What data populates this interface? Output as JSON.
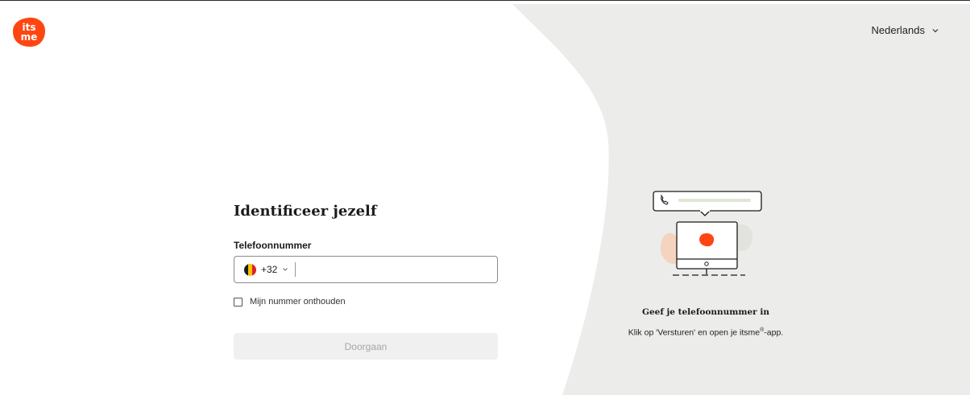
{
  "brand": {
    "logo_line1": "its",
    "logo_line2": "me",
    "accent": "#ff4612",
    "panel_bg": "#ececea"
  },
  "header": {
    "language": "Nederlands",
    "language_icon": "chevron-down-icon"
  },
  "form": {
    "title": "Identificeer jezelf",
    "phone_label": "Telefoonnummer",
    "country_code": "+32",
    "country_flag": "belgium-flag-icon",
    "phone_value": "",
    "remember_label": "Mijn nummer onthouden",
    "remember_checked": false,
    "continue_label": "Doorgaan"
  },
  "info": {
    "title": "Geef je telefoonnummer in",
    "text_before": "Klik op 'Versturen' en open je itsme",
    "text_sup": "®",
    "text_after": "-app."
  }
}
